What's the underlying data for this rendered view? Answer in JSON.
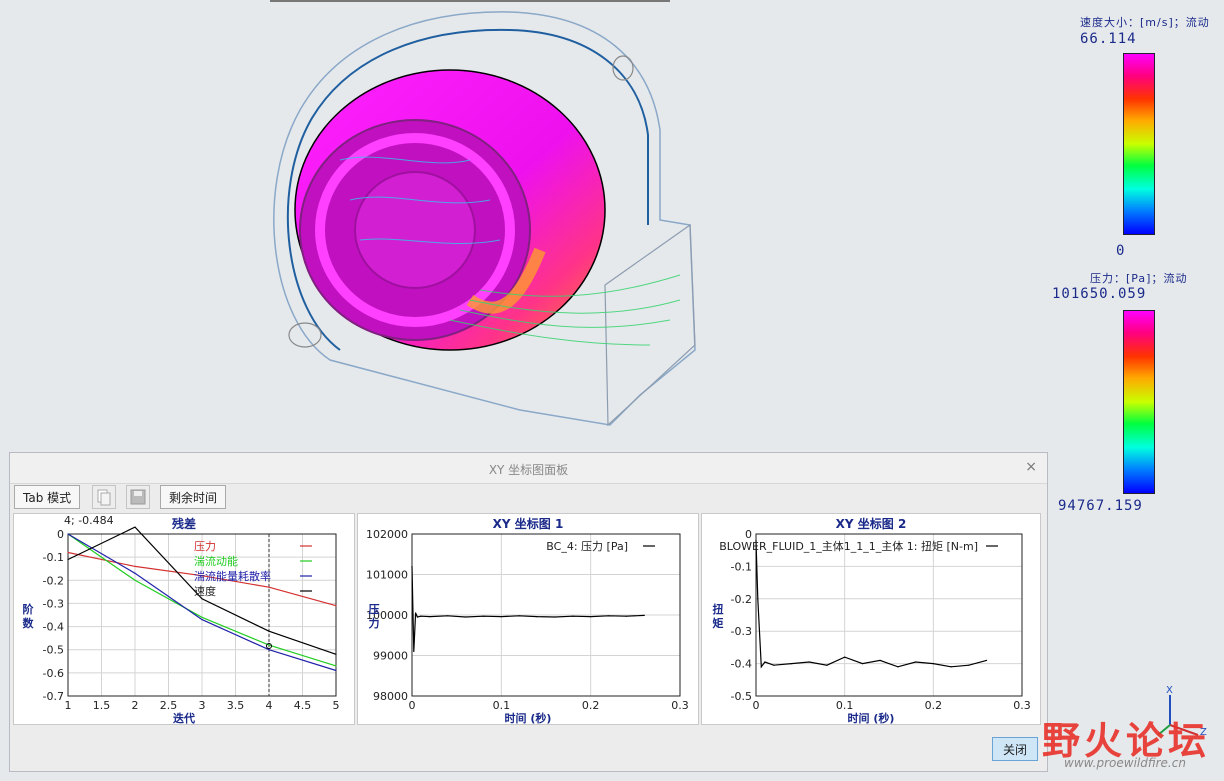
{
  "legend_velocity": {
    "title": "速度大小：[m/s]；流动",
    "max": "66.114",
    "min": "0"
  },
  "legend_pressure": {
    "title": "压力：[Pa]；流动",
    "max": "101650.059",
    "min": "94767.159"
  },
  "panel": {
    "title": "XY 坐标图面板",
    "close_icon": "×",
    "tab_mode_label": "Tab 模式",
    "remaining_time_label": "剩余时间",
    "close_button_label": "关闭"
  },
  "triad": {
    "x_label": "X",
    "z_label": "Z"
  },
  "watermark": {
    "text": "野火论坛",
    "url": "www.proewildfire.cn"
  },
  "colors": {
    "accent": "#1a2a8a",
    "pressure_series": "#d43030",
    "tke_series": "#22cc22",
    "dissipation_series": "#2222aa",
    "velocity_series": "#000000"
  },
  "chart_data": [
    {
      "type": "line",
      "title": "残差",
      "xlabel": "迭代",
      "ylabel": "阶\n数",
      "readout": "4; -0.484",
      "xlim": [
        1,
        5
      ],
      "ylim": [
        -0.7,
        0
      ],
      "xticks": [
        "1",
        "1.5",
        "2",
        "2.5",
        "3",
        "3.5",
        "4",
        "4.5",
        "5"
      ],
      "yticks": [
        "0",
        "-0.1",
        "-0.2",
        "-0.3",
        "-0.4",
        "-0.5",
        "-0.6",
        "-0.7"
      ],
      "cursor_x": 4,
      "series": [
        {
          "name": "压力",
          "color": "#d43030",
          "x": [
            1,
            2,
            3,
            4,
            5
          ],
          "y": [
            -0.08,
            -0.14,
            -0.18,
            -0.23,
            -0.31
          ]
        },
        {
          "name": "湍流动能",
          "color": "#22cc22",
          "x": [
            1,
            2,
            3,
            4,
            5
          ],
          "y": [
            0.0,
            -0.2,
            -0.36,
            -0.48,
            -0.57
          ]
        },
        {
          "name": "湍流能量耗散率",
          "color": "#2222aa",
          "x": [
            1,
            2,
            3,
            4,
            5
          ],
          "y": [
            0.0,
            -0.17,
            -0.37,
            -0.5,
            -0.59
          ]
        },
        {
          "name": "速度",
          "color": "#000000",
          "x": [
            1,
            2,
            3,
            4,
            5
          ],
          "y": [
            -0.11,
            0.03,
            -0.28,
            -0.42,
            -0.52
          ]
        }
      ]
    },
    {
      "type": "line",
      "title": "XY 坐标图 1",
      "xlabel": "时间 (秒)",
      "ylabel": "压\n力",
      "xlim": [
        0,
        0.3
      ],
      "ylim": [
        98000,
        102000
      ],
      "xticks": [
        "0",
        "0.1",
        "0.2",
        "0.3"
      ],
      "yticks": [
        "102000",
        "101000",
        "100000",
        "99000",
        "98000"
      ],
      "series": [
        {
          "name": "BC_4: 压力 [Pa]",
          "color": "#000000",
          "x": [
            0,
            0.002,
            0.004,
            0.006,
            0.01,
            0.02,
            0.04,
            0.06,
            0.08,
            0.1,
            0.12,
            0.14,
            0.16,
            0.18,
            0.2,
            0.22,
            0.24,
            0.26
          ],
          "y": [
            101200,
            99100,
            100050,
            99950,
            99970,
            99960,
            99980,
            99950,
            99970,
            99960,
            99980,
            99960,
            99950,
            99970,
            99960,
            99980,
            99970,
            99990
          ]
        }
      ]
    },
    {
      "type": "line",
      "title": "XY 坐标图 2",
      "xlabel": "时间 (秒)",
      "ylabel": "扭\n矩",
      "xlim": [
        0,
        0.3
      ],
      "ylim": [
        -0.5,
        0
      ],
      "xticks": [
        "0",
        "0.1",
        "0.2",
        "0.3"
      ],
      "yticks": [
        "0",
        "-0.1",
        "-0.2",
        "-0.3",
        "-0.4",
        "-0.5"
      ],
      "series": [
        {
          "name": "BLOWER_FLUID_1_主体1_1_1_主体 1: 扭矩 [N-m]",
          "color": "#000000",
          "x": [
            0,
            0.002,
            0.006,
            0.01,
            0.02,
            0.04,
            0.06,
            0.08,
            0.1,
            0.12,
            0.14,
            0.16,
            0.18,
            0.2,
            0.22,
            0.24,
            0.26
          ],
          "y": [
            -0.02,
            -0.2,
            -0.41,
            -0.395,
            -0.405,
            -0.4,
            -0.395,
            -0.405,
            -0.38,
            -0.4,
            -0.39,
            -0.41,
            -0.395,
            -0.4,
            -0.41,
            -0.405,
            -0.39
          ]
        }
      ]
    }
  ]
}
